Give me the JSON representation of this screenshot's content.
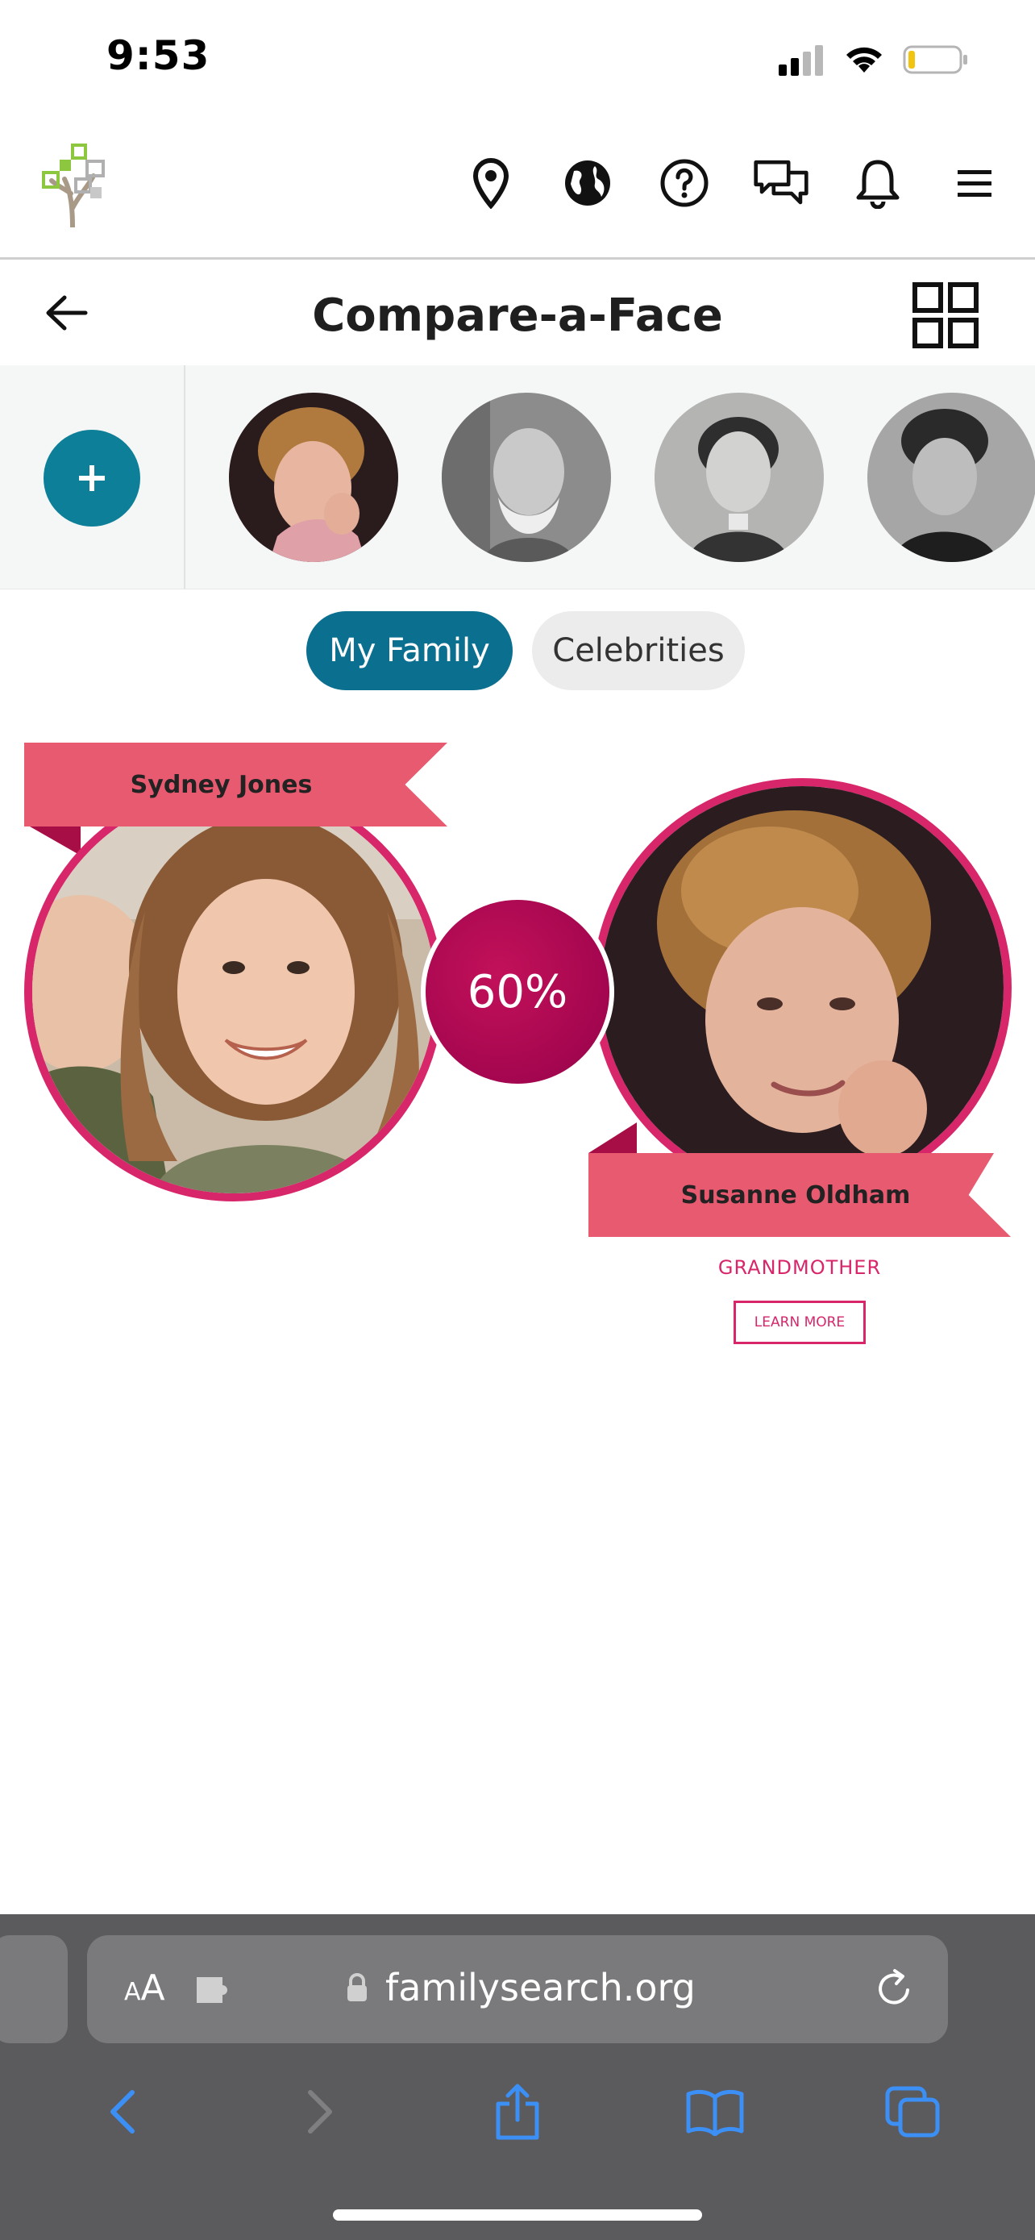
{
  "status_bar": {
    "time": "9:53"
  },
  "header": {
    "logo_name": "familysearch-tree-logo",
    "icons": [
      "location-pin-icon",
      "globe-icon",
      "help-icon",
      "chat-icon",
      "bell-icon",
      "menu-icon"
    ]
  },
  "title_bar": {
    "title": "Compare-a-Face"
  },
  "face_strip": {
    "add_label": "+"
  },
  "toggle": {
    "my_family": "My Family",
    "celebrities": "Celebrities",
    "selected": "My Family"
  },
  "comparison": {
    "left_name": "Sydney Jones",
    "right_name": "Susanne Oldham",
    "match_percent": "60%",
    "relationship": "GRANDMOTHER",
    "learn_more": "LEARN MORE"
  },
  "browser": {
    "aa_small": "A",
    "aa_large": "A",
    "domain": "familysearch.org"
  },
  "colors": {
    "accent_teal": "#0b6f8f",
    "ribbon_pink": "#e85a70",
    "match_magenta": "#a4064f",
    "border_pink": "#d8266a"
  }
}
